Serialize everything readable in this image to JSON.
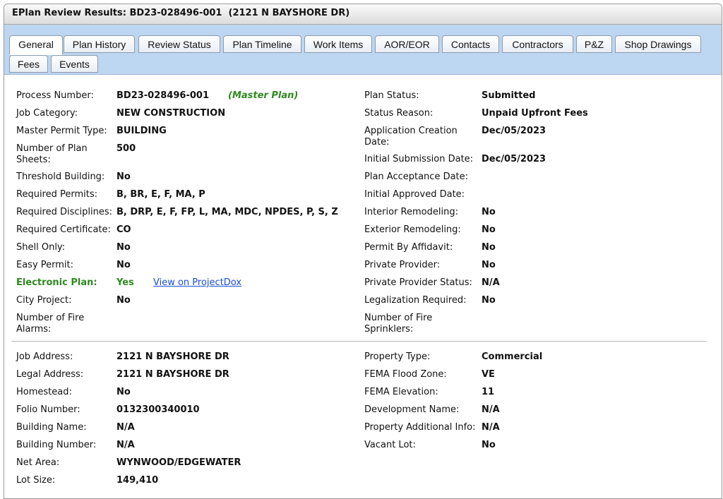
{
  "window": {
    "title": "EPlan Review Results: BD23-028496-001  (2121 N BAYSHORE DR)"
  },
  "tabs": [
    "General",
    "Plan History",
    "Review Status",
    "Plan Timeline",
    "Work Items",
    "AOR/EOR",
    "Contacts",
    "Contractors",
    "P&Z",
    "Shop Drawings",
    "Fees",
    "Events"
  ],
  "active_tab": "General",
  "colors": {
    "tab_bar": "#bdd6f1",
    "green": "#2f8a1f",
    "link": "#1a4fd6"
  },
  "left": {
    "process_number": {
      "label": "Process Number:",
      "value": "BD23-028496-001",
      "tag": "(Master Plan)"
    },
    "job_category": {
      "label": "Job Category:",
      "value": "NEW CONSTRUCTION"
    },
    "master_permit_type": {
      "label": "Master Permit Type:",
      "value": "BUILDING"
    },
    "plan_sheets": {
      "label": "Number of Plan Sheets:",
      "value": "500"
    },
    "threshold_building": {
      "label": "Threshold Building:",
      "value": "No"
    },
    "required_permits": {
      "label": "Required Permits:",
      "value": "B, BR, E, F, MA, P"
    },
    "required_disciplines": {
      "label": "Required Disciplines:",
      "value": "B, DRP, E, F, FP, L, MA, MDC, NPDES, P, S, Z"
    },
    "required_certificate": {
      "label": "Required Certificate:",
      "value": "CO"
    },
    "shell_only": {
      "label": "Shell Only:",
      "value": "No"
    },
    "easy_permit": {
      "label": "Easy Permit:",
      "value": "No"
    },
    "electronic_plan": {
      "label": "Electronic Plan:",
      "value": "Yes",
      "link": "View on ProjectDox"
    },
    "city_project": {
      "label": "City Project:",
      "value": "No"
    },
    "fire_alarms": {
      "label": "Number of Fire Alarms:",
      "value": ""
    }
  },
  "right": {
    "plan_status": {
      "label": "Plan Status:",
      "value": "Submitted"
    },
    "status_reason": {
      "label": "Status Reason:",
      "value": "Unpaid Upfront Fees"
    },
    "application_creation_date": {
      "label": "Application Creation Date:",
      "value": "Dec/05/2023"
    },
    "initial_submission_date": {
      "label": "Initial Submission Date:",
      "value": "Dec/05/2023"
    },
    "plan_acceptance_date": {
      "label": "Plan Acceptance Date:",
      "value": ""
    },
    "initial_approved_date": {
      "label": "Initial Approved Date:",
      "value": ""
    },
    "interior_remodeling": {
      "label": "Interior Remodeling:",
      "value": "No"
    },
    "exterior_remodeling": {
      "label": "Exterior Remodeling:",
      "value": "No"
    },
    "permit_by_affidavit": {
      "label": "Permit By Affidavit:",
      "value": "No"
    },
    "private_provider": {
      "label": "Private Provider:",
      "value": "No"
    },
    "private_provider_status": {
      "label": "Private Provider Status:",
      "value": "N/A"
    },
    "legalization_required": {
      "label": "Legalization Required:",
      "value": "No"
    },
    "fire_sprinklers": {
      "label": "Number of Fire Sprinklers:",
      "value": ""
    }
  },
  "property_left": {
    "job_address": {
      "label": "Job Address:",
      "value": "2121 N BAYSHORE DR"
    },
    "legal_address": {
      "label": "Legal Address:",
      "value": "2121 N BAYSHORE DR"
    },
    "homestead": {
      "label": "Homestead:",
      "value": "No"
    },
    "folio_number": {
      "label": "Folio Number:",
      "value": "0132300340010"
    },
    "building_name": {
      "label": "Building Name:",
      "value": "N/A"
    },
    "building_number": {
      "label": "Building Number:",
      "value": "N/A"
    },
    "net_area": {
      "label": "Net Area:",
      "value": "WYNWOOD/EDGEWATER"
    },
    "lot_size": {
      "label": "Lot Size:",
      "value": "149,410"
    }
  },
  "property_right": {
    "property_type": {
      "label": "Property Type:",
      "value": "Commercial"
    },
    "fema_flood_zone": {
      "label": "FEMA Flood Zone:",
      "value": "VE"
    },
    "fema_elevation": {
      "label": "FEMA Elevation:",
      "value": "11"
    },
    "development_name": {
      "label": "Development Name:",
      "value": "N/A"
    },
    "property_additional_info": {
      "label": "Property Additional Info:",
      "value": "N/A"
    },
    "vacant_lot": {
      "label": "Vacant Lot:",
      "value": "No"
    }
  }
}
